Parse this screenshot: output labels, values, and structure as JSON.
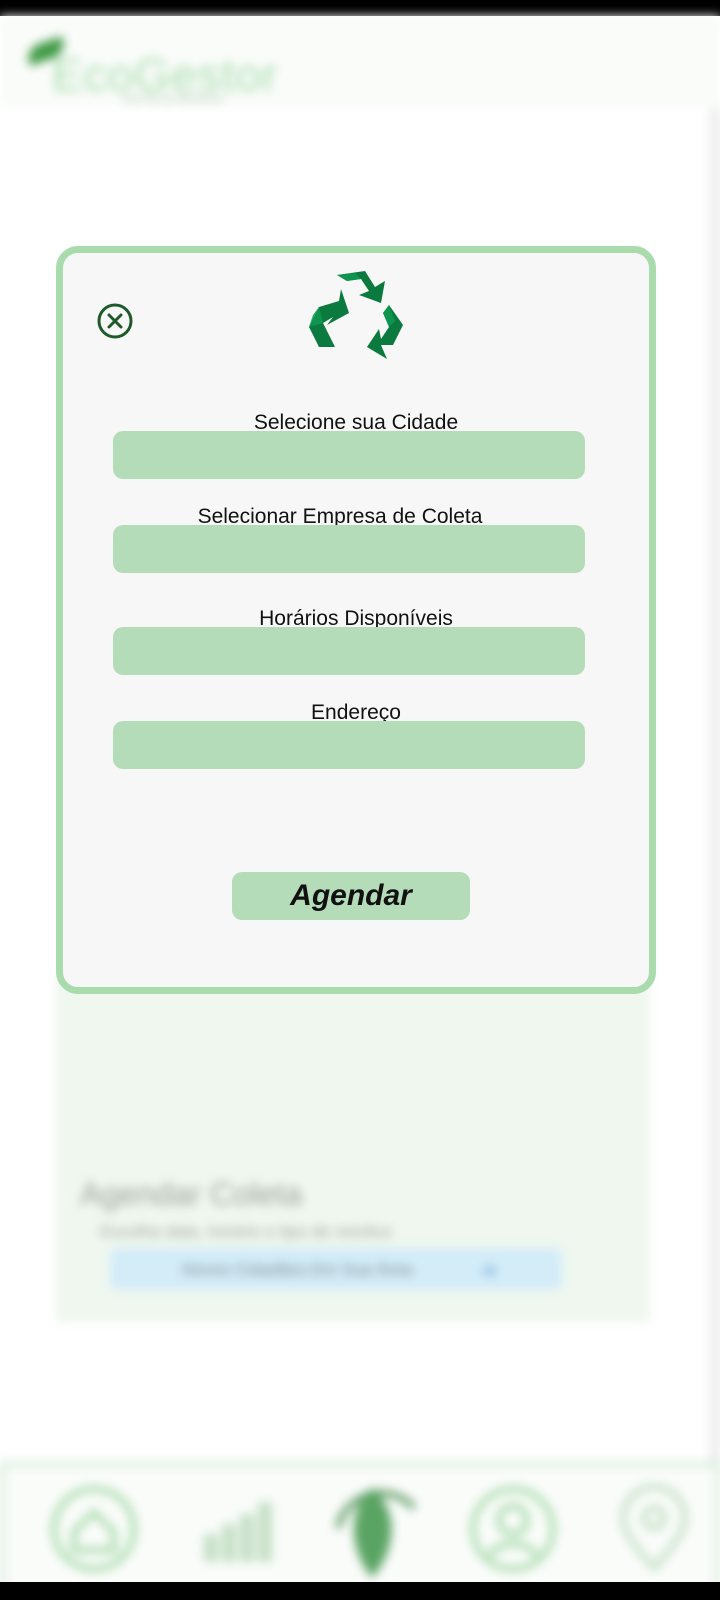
{
  "app": {
    "logo_text": "EcoGestor",
    "logo_subtitle": "GESTÃO DE RESÍDUOS"
  },
  "background": {
    "card_title": "Agendar Coleta",
    "card_subtitle": "Escolha data, horário e tipo de resíduo",
    "card_button_label": "Novos Cidadãos Em Sua Área",
    "card_button_icon": "arrow-right-icon"
  },
  "modal": {
    "close_icon": "close-circle-icon",
    "recycle_icon": "recycle-icon",
    "fields": {
      "city_label": "Selecione sua Cidade",
      "company_label": "Selecionar Empresa de Coleta",
      "hours_label": "Horários Disponíveis",
      "address_label": "Endereço"
    },
    "submit_label": "Agendar",
    "colors": {
      "border": "#a9dbac",
      "field_bg": "#b5dcb9",
      "icon_green": "#0b7a3e"
    }
  },
  "navbar": {
    "items": [
      "home-icon",
      "chart-icon",
      "leaf-icon",
      "user-icon",
      "map-pin-icon"
    ]
  }
}
